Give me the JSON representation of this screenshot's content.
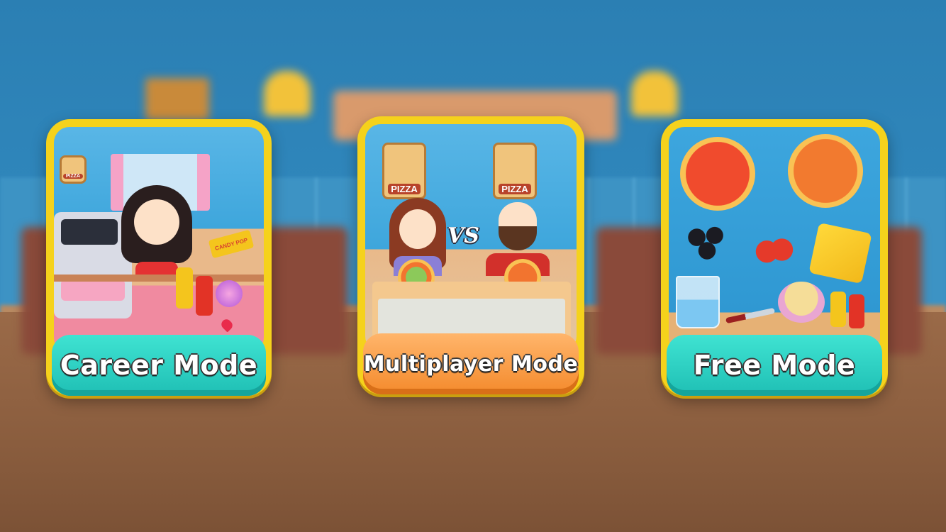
{
  "modes": {
    "career": {
      "label": "Career Mode",
      "sign": "PIZZA",
      "candy_sign": "CANDY POP"
    },
    "multiplayer": {
      "label": "Multiplayer Mode",
      "sign_left": "PIZZA",
      "sign_right": "PIZZA",
      "versus": "VS"
    },
    "free": {
      "label": "Free Mode"
    }
  },
  "colors": {
    "card_border": "#f5d21c",
    "teal_button": "#2fd1c4",
    "orange_button": "#f6993c",
    "wall": "#2f86bb",
    "floor": "#8a5d3e"
  }
}
